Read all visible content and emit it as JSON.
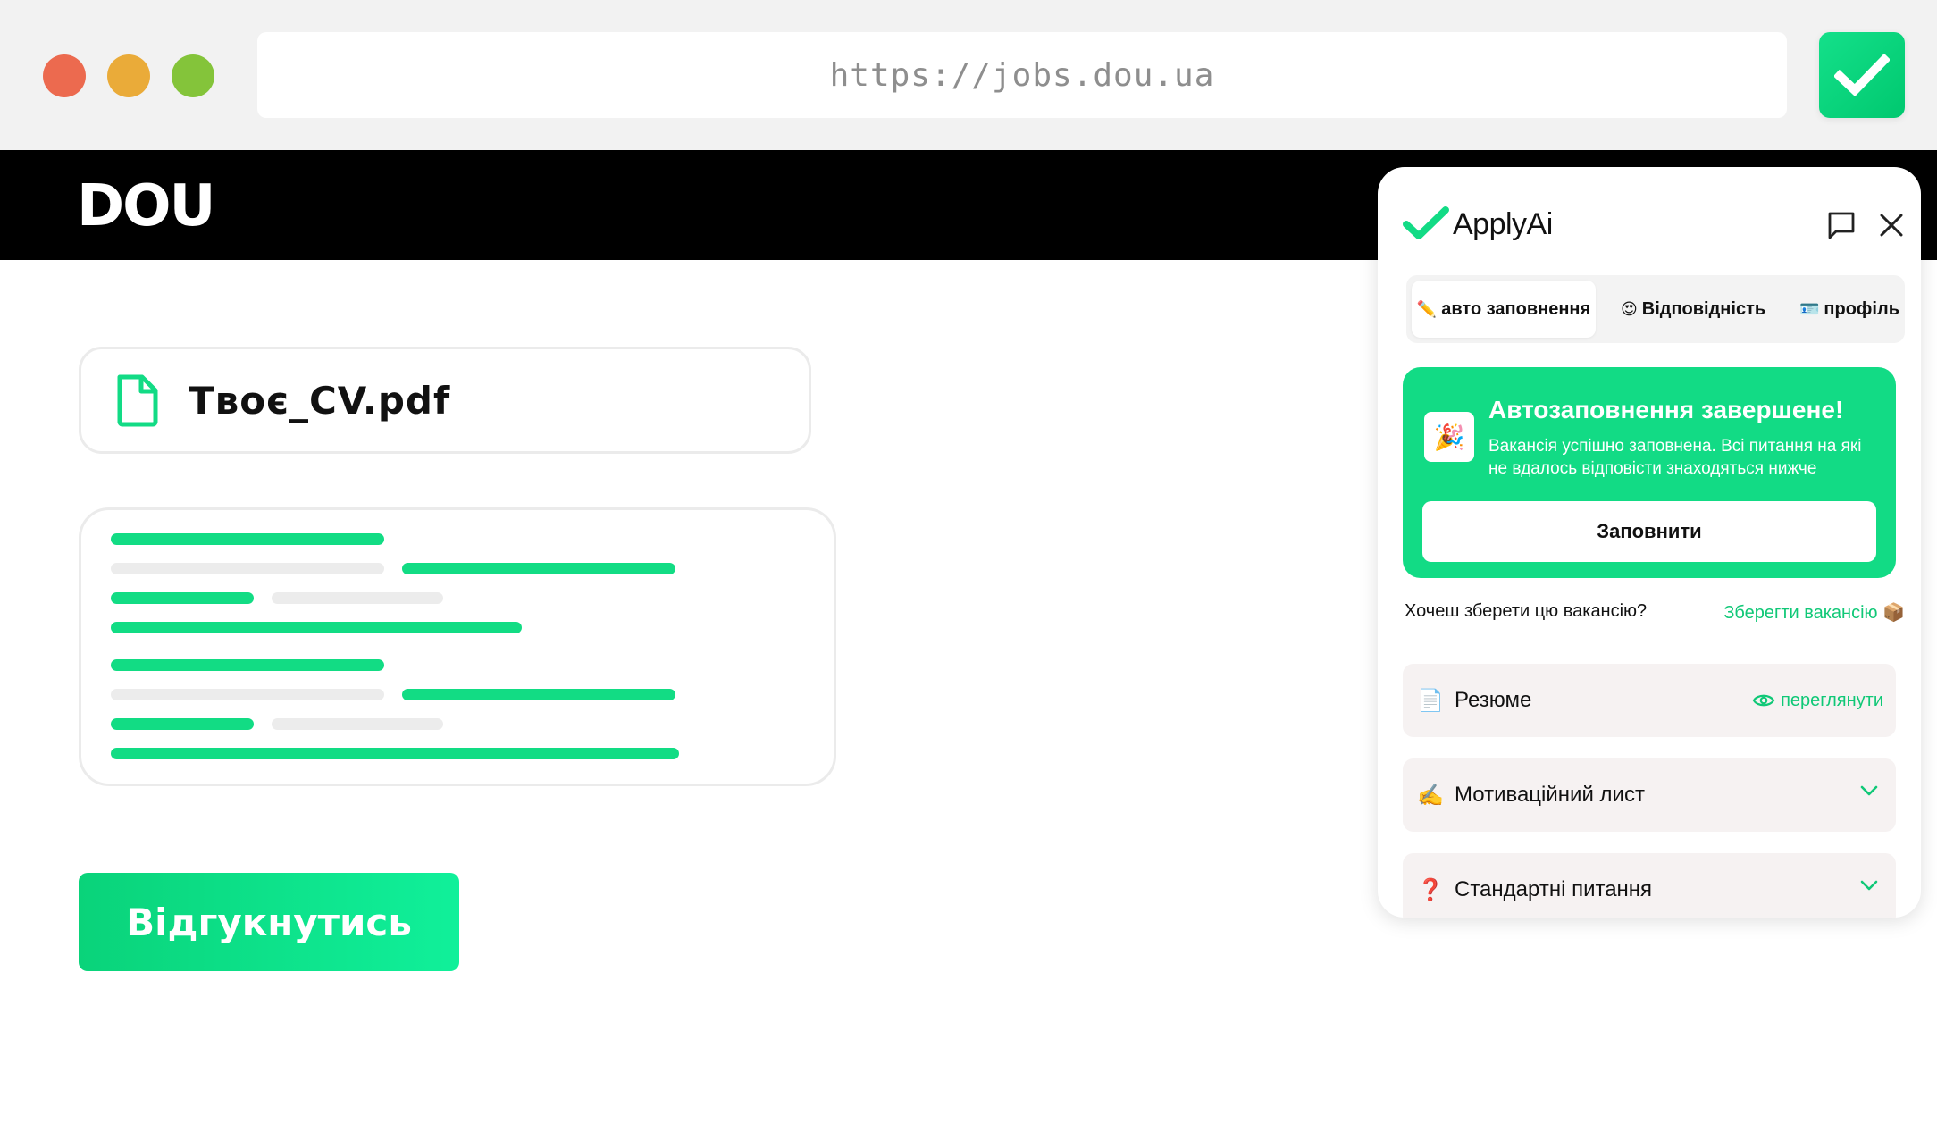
{
  "browser": {
    "url": "https://jobs.dou.ua",
    "traffic_lights": [
      "#ec6a4f",
      "#eaab39",
      "#84c43a"
    ]
  },
  "site": {
    "logo": "DOU",
    "file_name": "Твоє_CV.pdf",
    "apply_button": "Відгукнутись"
  },
  "extension": {
    "name": "ApplyAi",
    "tabs": [
      {
        "emoji": "✏️",
        "label": "авто заповнення"
      },
      {
        "emoji": "😍",
        "label": "Відповідність"
      },
      {
        "emoji": "🪪",
        "label": "профіль"
      }
    ],
    "status": {
      "emoji": "🎉",
      "title": "Автозаповнення завершене!",
      "description": "Вакансія успішно заповнена. Всі питання на які не вдалось відповісти знаходяться нижче",
      "button": "Заповнити"
    },
    "save_prompt": "Хочеш зберети цю вакансію?",
    "save_link": "Зберегти вакансію",
    "save_emoji": "📦",
    "sections": [
      {
        "emoji": "📄",
        "label": "Резюме",
        "action": "переглянути"
      },
      {
        "emoji": "✍️",
        "label": "Мотиваційний лист"
      },
      {
        "emoji": "❓",
        "label": "Стандартні питання"
      }
    ],
    "accent": "#12db85"
  }
}
